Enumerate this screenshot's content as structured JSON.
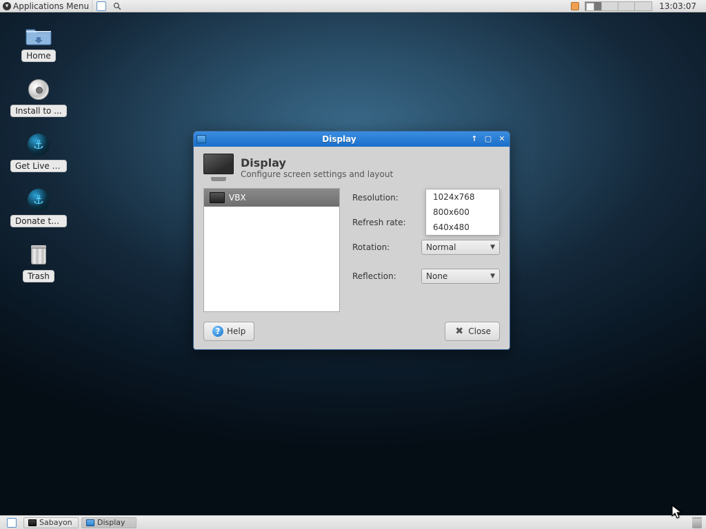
{
  "top_panel": {
    "apps_menu": "Applications Menu",
    "clock": "13:03:07",
    "workspaces": 4,
    "active_workspace": 0
  },
  "desktop": {
    "icons": [
      {
        "name": "home",
        "label": "Home"
      },
      {
        "name": "install",
        "label": "Install to ..."
      },
      {
        "name": "live",
        "label": "Get Live H..."
      },
      {
        "name": "donate",
        "label": "Donate to..."
      },
      {
        "name": "trash",
        "label": "Trash"
      }
    ]
  },
  "dialog": {
    "title": "Display",
    "heading": "Display",
    "subheading": "Configure screen settings and layout",
    "displays": [
      {
        "name": "VBX"
      }
    ],
    "settings": {
      "resolution_label": "Resolution:",
      "resolution_options": [
        "1024x768",
        "800x600",
        "640x480"
      ],
      "refresh_label": "Refresh rate:",
      "rotation_label": "Rotation:",
      "rotation_value": "Normal",
      "reflection_label": "Reflection:",
      "reflection_value": "None"
    },
    "buttons": {
      "help": "Help",
      "close": "Close"
    }
  },
  "taskbar": {
    "items": [
      {
        "name": "sabayon",
        "label": "Sabayon",
        "active": false
      },
      {
        "name": "display",
        "label": "Display",
        "active": true
      }
    ]
  }
}
